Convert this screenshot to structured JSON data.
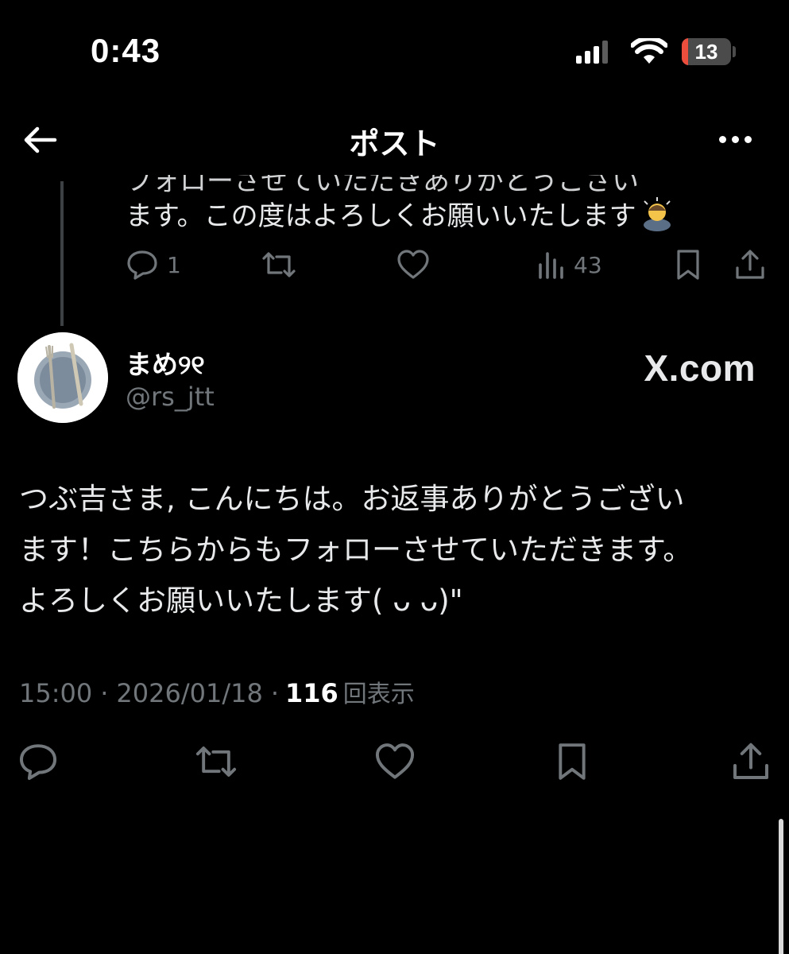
{
  "status_bar": {
    "time": "0:43",
    "battery_level": "13",
    "battery_color": "#eb4e3d"
  },
  "header": {
    "title": "ポスト",
    "back_icon": "arrow-left-icon",
    "more_icon": "more-horizontal-icon"
  },
  "previous_post": {
    "text_cutoff": "フォローさせていただきありがとうござい",
    "text": "ます。この度はよろしくお願いいたします",
    "emoji": "person-bowing",
    "reply_count": "1",
    "view_count": "43"
  },
  "main_post": {
    "display_name": "まめ୨୧",
    "handle": "@rs_jtt",
    "watermark": "X.com",
    "body_lines": [
      "つぶ吉さま, こんにちは。お返事ありがとうござい",
      "ます！こちらからもフォローさせていただきます。",
      "よろしくお願いいたします( ᴗ ᴗ)\""
    ],
    "time": "15:00",
    "separator": "·",
    "date": "2026/01/18",
    "views": "116",
    "views_label": "回表示"
  },
  "colors": {
    "background": "#000000",
    "text_primary": "#e7e9ea",
    "text_secondary": "#71767b",
    "thread_line": "#3e4144"
  }
}
